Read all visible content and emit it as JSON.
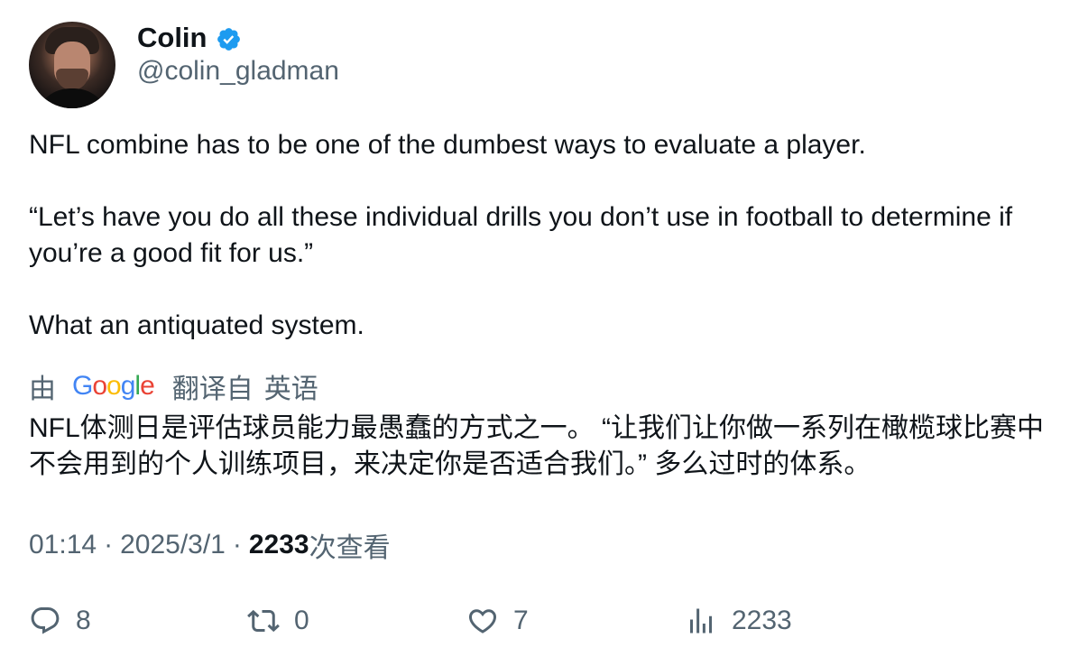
{
  "author": {
    "name": "Colin",
    "handle": "@colin_gladman",
    "verified_color": "#1d9bf0"
  },
  "tweet": {
    "line1": "NFL combine has to be one of the dumbest ways to evaluate a player.",
    "line2": "“Let’s have you do all these individual drills you don’t use in football to determine if you’re a good fit for us.”",
    "line3": "What an antiquated system."
  },
  "translation": {
    "by_prefix": "由",
    "provider": "Google",
    "label": "翻译自",
    "source_language": "英语",
    "text": "NFL体测日是评估球员能力最愚蠢的方式之一。 “让我们让你做一系列在橄榄球比赛中不会用到的个人训练项目，来决定你是否适合我们。” 多么过时的体系。"
  },
  "meta": {
    "time": "01:14",
    "separator": "·",
    "date": "2025/3/1",
    "views_count": "2233",
    "views_label": "次查看"
  },
  "actions": {
    "replies": {
      "icon": "reply-icon",
      "count": "8"
    },
    "retweets": {
      "icon": "retweet-icon",
      "count": "0"
    },
    "likes": {
      "icon": "like-icon",
      "count": "7"
    },
    "views": {
      "icon": "views-icon",
      "count": "2233"
    }
  }
}
